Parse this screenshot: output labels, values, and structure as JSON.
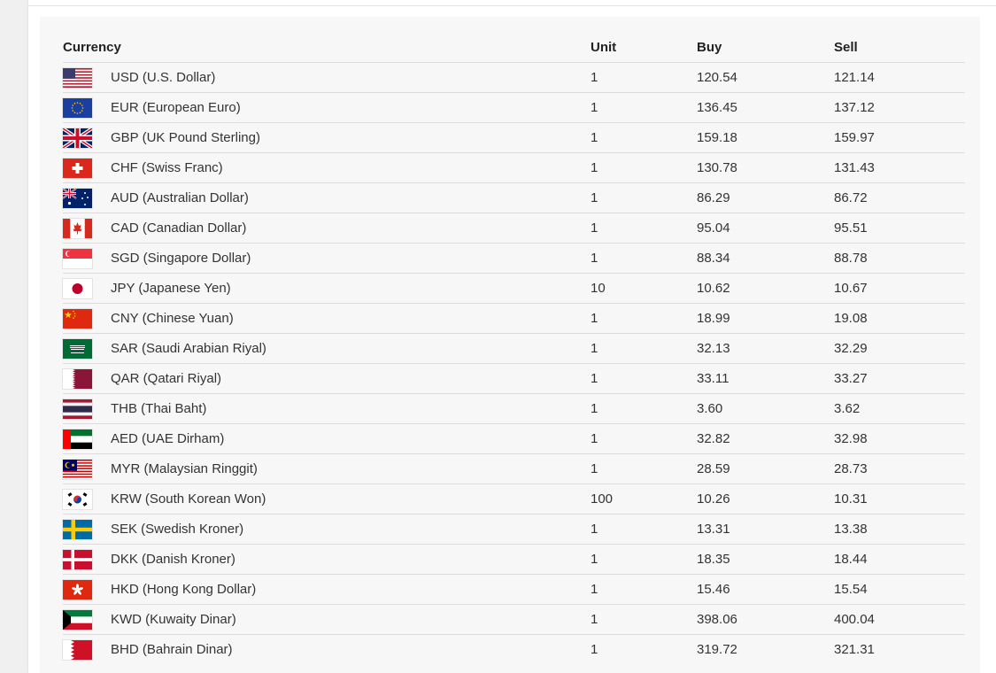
{
  "table": {
    "headers": {
      "currency": "Currency",
      "unit": "Unit",
      "buy": "Buy",
      "sell": "Sell"
    },
    "rows": [
      {
        "flag": "us-flag-icon",
        "name": "USD (U.S. Dollar)",
        "unit": "1",
        "buy": "120.54",
        "sell": "121.14"
      },
      {
        "flag": "eu-flag-icon",
        "name": "EUR (European Euro)",
        "unit": "1",
        "buy": "136.45",
        "sell": "137.12"
      },
      {
        "flag": "uk-flag-icon",
        "name": "GBP (UK Pound Sterling)",
        "unit": "1",
        "buy": "159.18",
        "sell": "159.97"
      },
      {
        "flag": "swiss-flag-icon",
        "name": "CHF (Swiss Franc)",
        "unit": "1",
        "buy": "130.78",
        "sell": "131.43"
      },
      {
        "flag": "australia-flag-icon",
        "name": "AUD (Australian Dollar)",
        "unit": "1",
        "buy": "86.29",
        "sell": "86.72"
      },
      {
        "flag": "canada-flag-icon",
        "name": "CAD (Canadian Dollar)",
        "unit": "1",
        "buy": "95.04",
        "sell": "95.51"
      },
      {
        "flag": "singapore-flag-icon",
        "name": "SGD (Singapore Dollar)",
        "unit": "1",
        "buy": "88.34",
        "sell": "88.78"
      },
      {
        "flag": "japan-flag-icon",
        "name": "JPY (Japanese Yen)",
        "unit": "10",
        "buy": "10.62",
        "sell": "10.67"
      },
      {
        "flag": "china-flag-icon",
        "name": "CNY (Chinese Yuan)",
        "unit": "1",
        "buy": "18.99",
        "sell": "19.08"
      },
      {
        "flag": "saudi-flag-icon",
        "name": "SAR (Saudi Arabian Riyal)",
        "unit": "1",
        "buy": "32.13",
        "sell": "32.29"
      },
      {
        "flag": "qatar-flag-icon",
        "name": "QAR (Qatari Riyal)",
        "unit": "1",
        "buy": "33.11",
        "sell": "33.27"
      },
      {
        "flag": "thailand-flag-icon",
        "name": "THB (Thai Baht)",
        "unit": "1",
        "buy": "3.60",
        "sell": "3.62"
      },
      {
        "flag": "uae-flag-icon",
        "name": "AED (UAE Dirham)",
        "unit": "1",
        "buy": "32.82",
        "sell": "32.98"
      },
      {
        "flag": "malaysia-flag-icon",
        "name": "MYR (Malaysian Ringgit)",
        "unit": "1",
        "buy": "28.59",
        "sell": "28.73"
      },
      {
        "flag": "south-korea-flag-icon",
        "name": "KRW (South Korean Won)",
        "unit": "100",
        "buy": "10.26",
        "sell": "10.31"
      },
      {
        "flag": "sweden-flag-icon",
        "name": "SEK (Swedish Kroner)",
        "unit": "1",
        "buy": "13.31",
        "sell": "13.38"
      },
      {
        "flag": "denmark-flag-icon",
        "name": "DKK (Danish Kroner)",
        "unit": "1",
        "buy": "18.35",
        "sell": "18.44"
      },
      {
        "flag": "hong-kong-flag-icon",
        "name": "HKD (Hong Kong Dollar)",
        "unit": "1",
        "buy": "15.46",
        "sell": "15.54"
      },
      {
        "flag": "kuwait-flag-icon",
        "name": "KWD (Kuwaity Dinar)",
        "unit": "1",
        "buy": "398.06",
        "sell": "400.04"
      },
      {
        "flag": "bahrain-flag-icon",
        "name": "BHD (Bahrain Dinar)",
        "unit": "1",
        "buy": "319.72",
        "sell": "321.31"
      }
    ]
  }
}
